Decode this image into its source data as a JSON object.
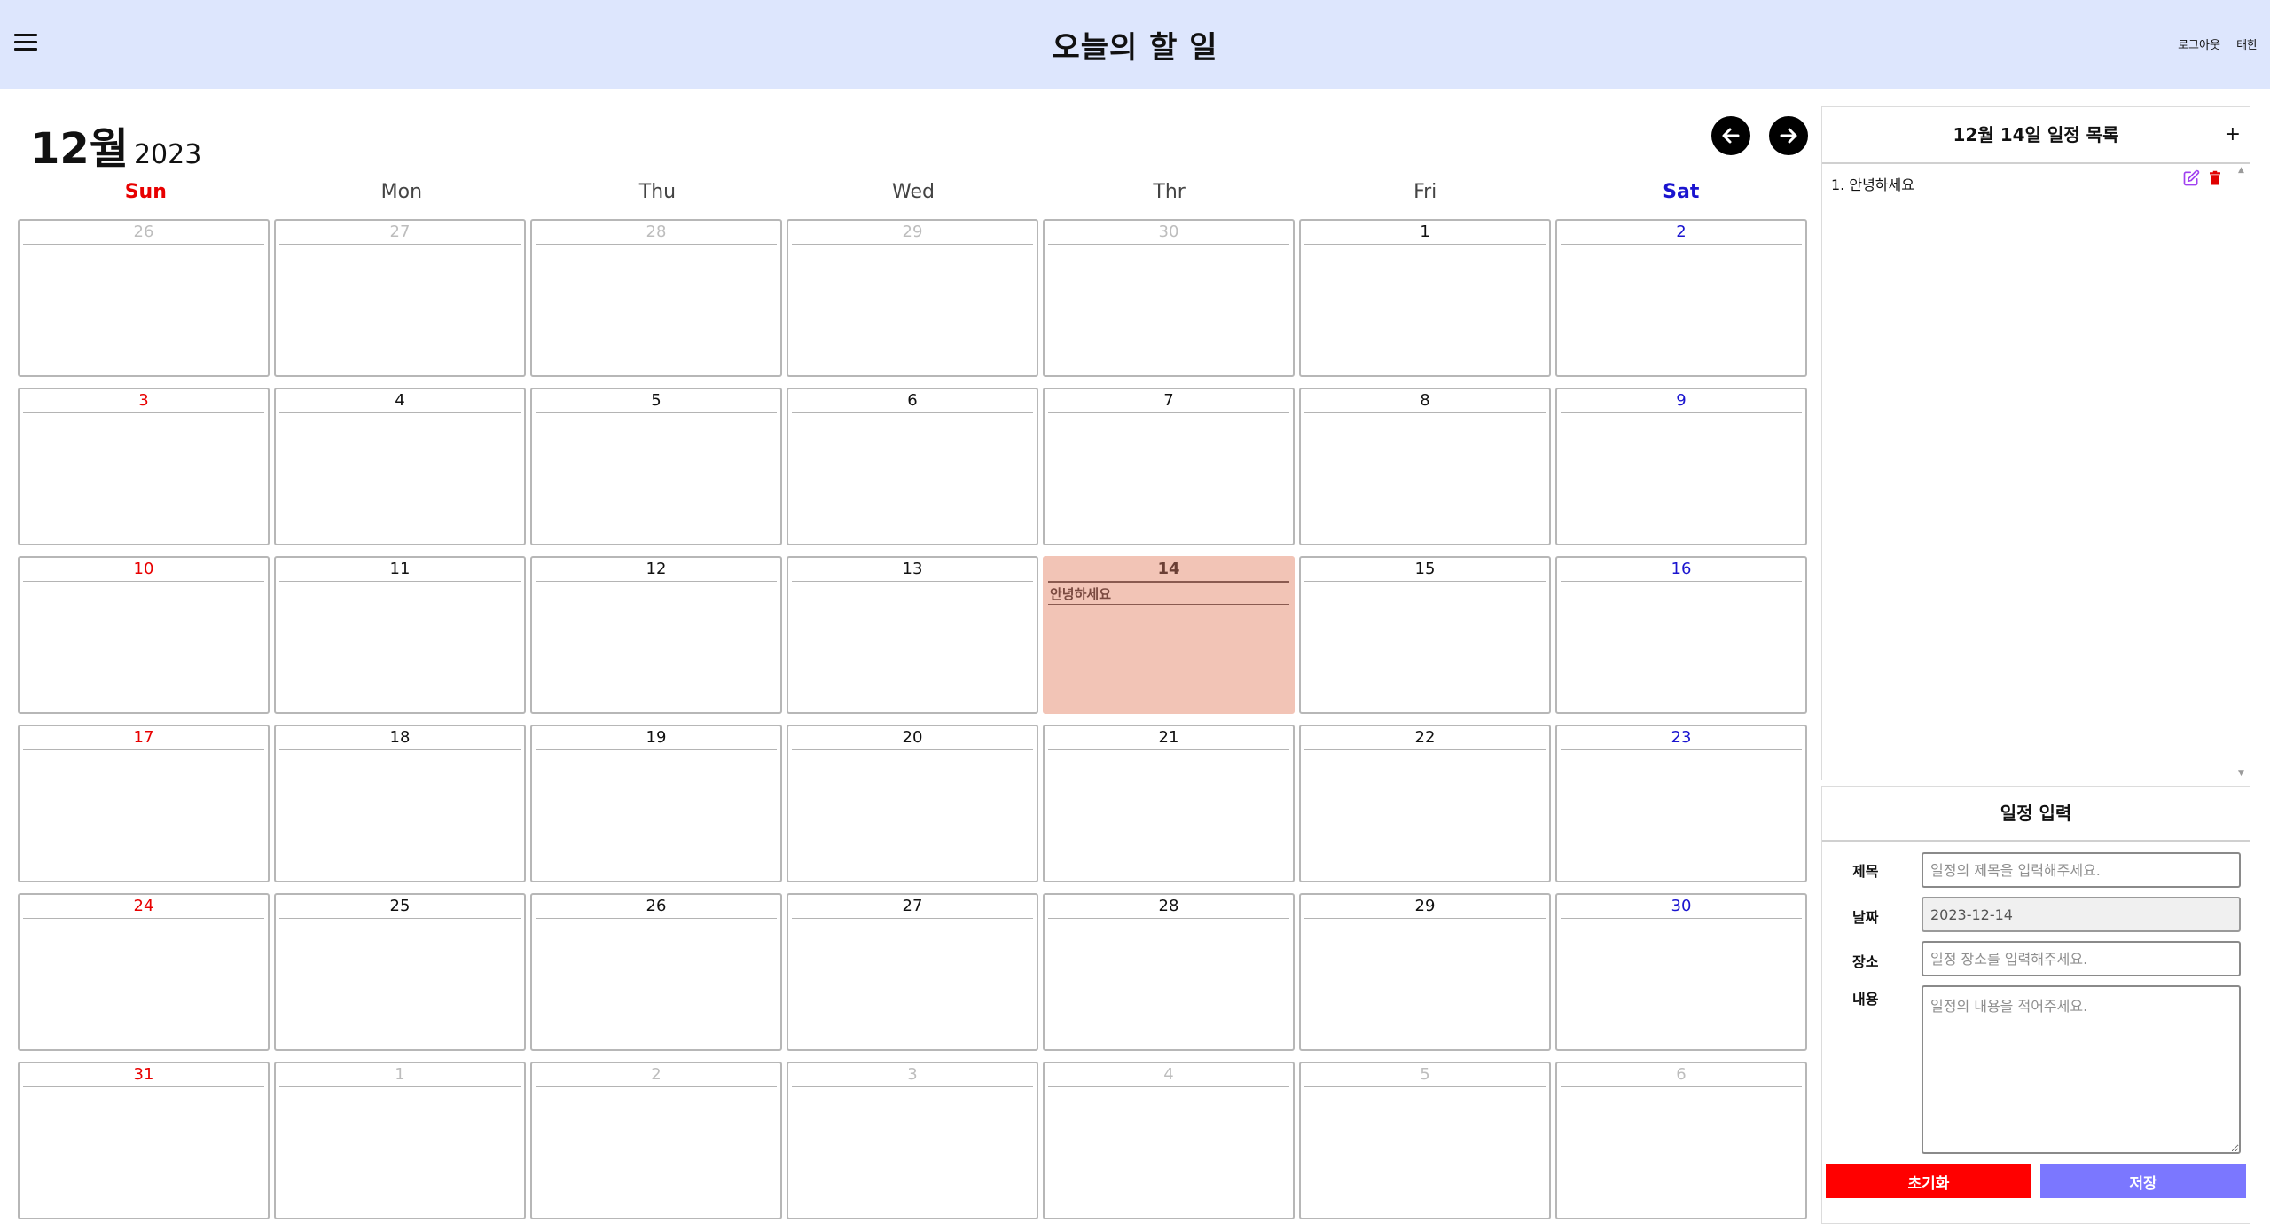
{
  "header": {
    "title": "오늘의 할 일",
    "logout": "로그아웃",
    "user": "태한"
  },
  "calendar": {
    "month_label": "12월",
    "year_label": "2023",
    "weekdays": [
      "Sun",
      "Mon",
      "Thu",
      "Wed",
      "Thr",
      "Fri",
      "Sat"
    ],
    "days": [
      "26",
      "27",
      "28",
      "29",
      "30",
      "1",
      "2",
      "3",
      "4",
      "5",
      "6",
      "7",
      "8",
      "9",
      "10",
      "11",
      "12",
      "13",
      "14",
      "15",
      "16",
      "17",
      "18",
      "19",
      "20",
      "21",
      "22",
      "23",
      "24",
      "25",
      "26",
      "27",
      "28",
      "29",
      "30",
      "31",
      "1",
      "2",
      "3",
      "4",
      "5",
      "6"
    ],
    "selected_event": "안녕하세요",
    "colors": {
      "sunday": "#e80000",
      "saturday": "#1a14cf",
      "selected": "#f2c4b6",
      "header": "#dde6fd"
    }
  },
  "schedule_list": {
    "title": "12월 14일 일정 목록",
    "add_label": "+",
    "items": [
      {
        "label": "1. 안녕하세요"
      }
    ]
  },
  "form": {
    "title": "일정 입력",
    "title_label": "제목",
    "title_placeholder": "일정의 제목을 입력해주세요.",
    "date_label": "날짜",
    "date_value": "2023-12-14",
    "place_label": "장소",
    "place_placeholder": "일정 장소를 입력해주세요.",
    "content_label": "내용",
    "content_placeholder": "일정의 내용을 적어주세요.",
    "reset_label": "초기화",
    "save_label": "저장",
    "colors": {
      "reset": "#ff0000",
      "save": "#7b77ff"
    }
  },
  "icons": [
    "menu-icon",
    "arrow-left-icon",
    "arrow-right-icon",
    "edit-icon",
    "trash-icon",
    "scroll-up-icon",
    "scroll-down-icon",
    "resize-handle-icon"
  ]
}
